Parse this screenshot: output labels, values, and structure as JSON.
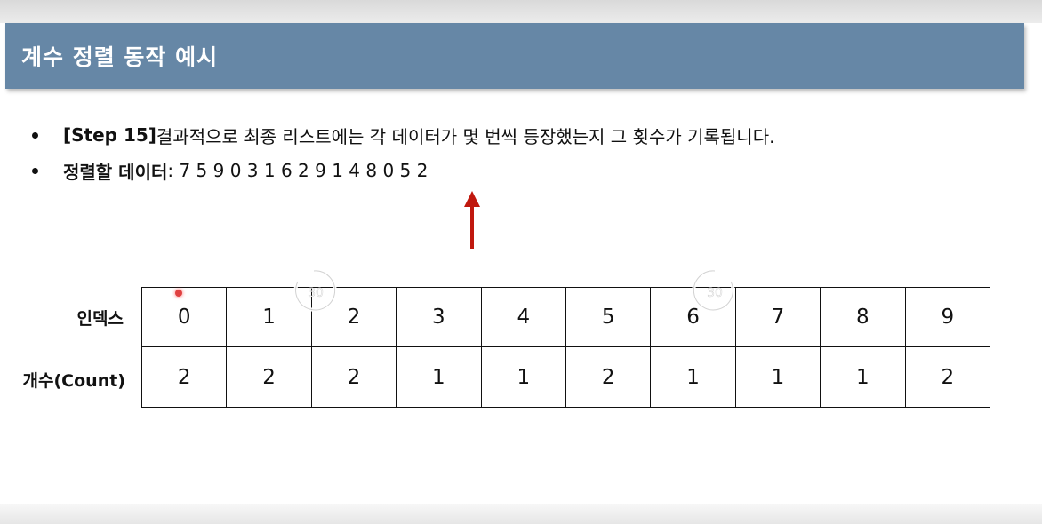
{
  "title": "계수 정렬 동작 예시",
  "bullets": [
    {
      "label": "[Step 15]",
      "text": " 결과적으로 최종 리스트에는 각 데이터가 몇 번씩 등장했는지 그 횟수가 기록됩니다."
    },
    {
      "label": "정렬할 데이터",
      "text": ": 7 5 9 0 3 1 6 2 9 1 4 8 0 5 2"
    }
  ],
  "table": {
    "index_label": "인덱스",
    "count_label": "개수(Count)",
    "indices": [
      "0",
      "1",
      "2",
      "3",
      "4",
      "5",
      "6",
      "7",
      "8",
      "9"
    ],
    "counts": [
      "2",
      "2",
      "2",
      "1",
      "1",
      "2",
      "1",
      "1",
      "1",
      "2"
    ]
  },
  "video_controls": {
    "rewind_seconds": "30",
    "forward_seconds": "30"
  },
  "colors": {
    "title_bar": "#6687a6",
    "arrow": "#c0180e"
  }
}
